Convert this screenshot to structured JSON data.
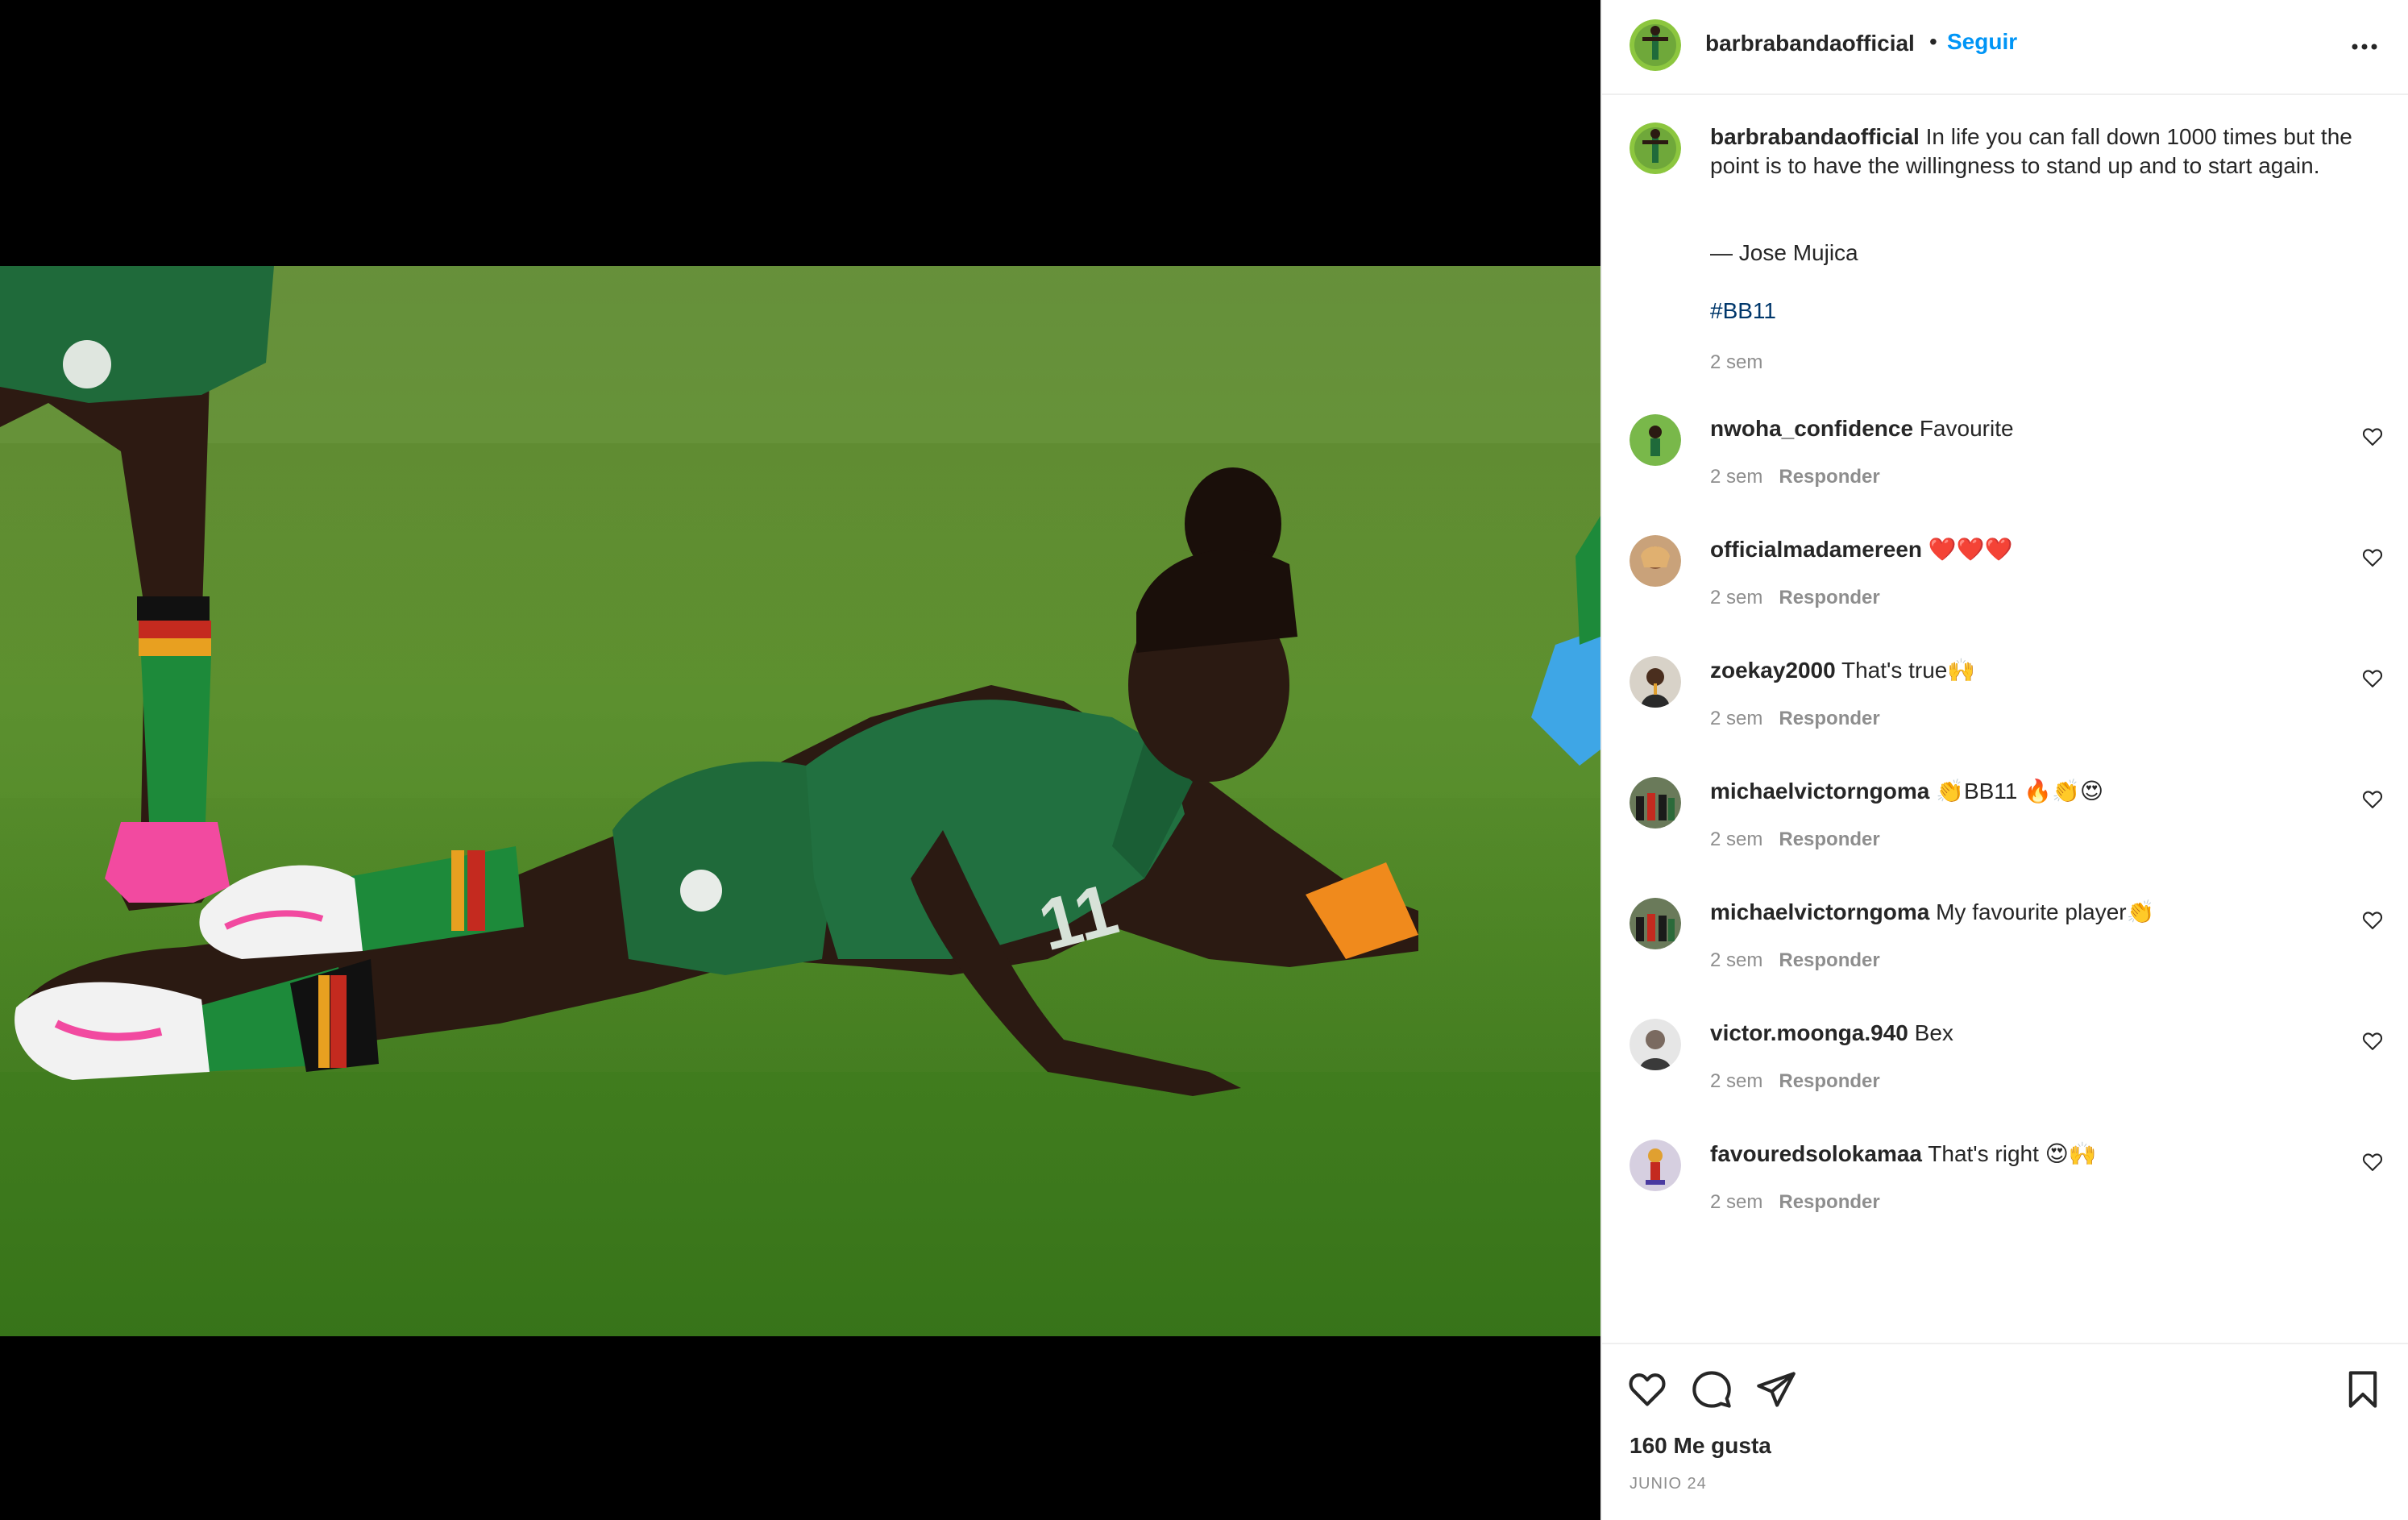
{
  "post": {
    "username": "barbrabandaofficial",
    "follow_label": "Seguir",
    "separator": "•",
    "caption_text": "In life you can fall down 1000 times but the point is to have the willingness to stand up and to start again.",
    "quote_author": "— Jose Mujica",
    "hashtag": "#BB11",
    "time": "2 sem"
  },
  "comments": [
    {
      "username": "nwoha_confidence",
      "text": "Favourite",
      "time": "2 sem",
      "reply": "Responder"
    },
    {
      "username": "officialmadamereen",
      "text": "❤️❤️❤️",
      "time": "2 sem",
      "reply": "Responder"
    },
    {
      "username": "zoekay2000",
      "text": "That's true🙌",
      "time": "2 sem",
      "reply": "Responder"
    },
    {
      "username": "michaelvictorngoma",
      "text": "👏BB11 🔥👏😍",
      "time": "2 sem",
      "reply": "Responder"
    },
    {
      "username": "michaelvictorngoma",
      "text": "My favourite player👏",
      "time": "2 sem",
      "reply": "Responder"
    },
    {
      "username": "victor.moonga.940",
      "text": "Bex",
      "time": "2 sem",
      "reply": "Responder"
    },
    {
      "username": "favouredsolokamaa",
      "text": "That's right 😍🙌",
      "time": "2 sem",
      "reply": "Responder"
    }
  ],
  "footer": {
    "likes": "160 Me gusta",
    "date": "JUNIO 24"
  },
  "icons": {
    "more": "more-options-icon",
    "like": "heart-icon",
    "comment": "comment-icon",
    "share": "share-icon",
    "save": "bookmark-icon"
  },
  "colors": {
    "link_blue": "#0095f6",
    "hashtag": "#00376b",
    "muted": "#8e8e8e",
    "text": "#262626"
  }
}
